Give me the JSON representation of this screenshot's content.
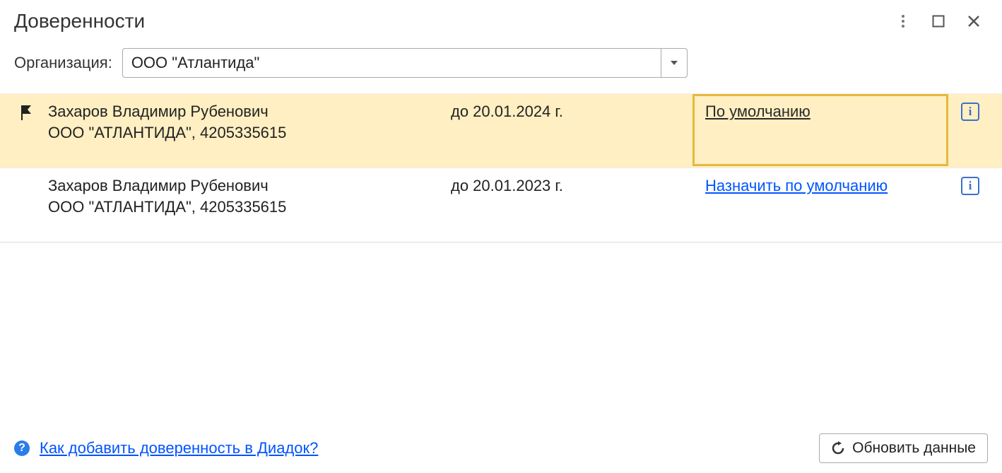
{
  "window": {
    "title": "Доверенности"
  },
  "filter": {
    "org_label": "Организация:",
    "org_value": "ООО \"Атлантида\""
  },
  "rows": [
    {
      "flagged": true,
      "selected": true,
      "name": "Захаров Владимир Рубенович",
      "org": "ООО \"АТЛАНТИДА\", 4205335615",
      "valid_until": "до 20.01.2024 г.",
      "default_state": "default",
      "default_label": "По умолчанию"
    },
    {
      "flagged": false,
      "selected": false,
      "name": "Захаров Владимир Рубенович",
      "org": "ООО \"АТЛАНТИДА\", 4205335615",
      "valid_until": "до 20.01.2023 г.",
      "default_state": "assignable",
      "default_label": "Назначить по умолчанию"
    }
  ],
  "footer": {
    "help_link": "Как добавить доверенность в Диадок?",
    "refresh_label": "Обновить данные"
  }
}
